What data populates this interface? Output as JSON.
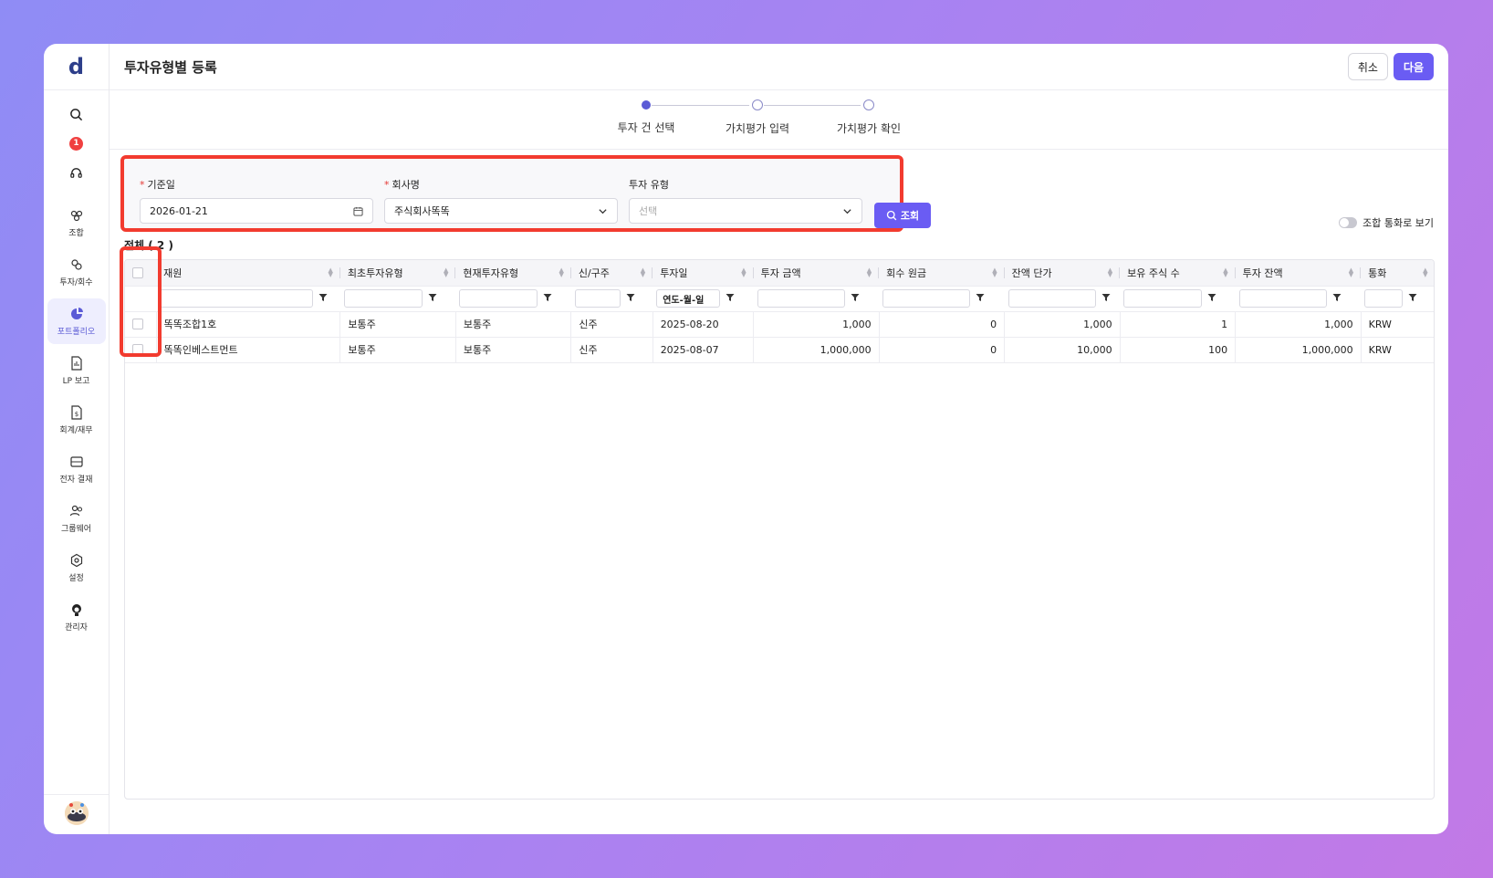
{
  "app": {
    "logo": "d"
  },
  "sidebar": {
    "notification_count": "1",
    "items": [
      {
        "label": "조합",
        "icon": "fund-icon",
        "active": false
      },
      {
        "label": "투자/회수",
        "icon": "invest-icon",
        "active": false
      },
      {
        "label": "포트폴리오",
        "icon": "portfolio-pie-icon",
        "active": true
      },
      {
        "label": "LP 보고",
        "icon": "report-icon",
        "active": false
      },
      {
        "label": "회계/재무",
        "icon": "accounting-icon",
        "active": false
      },
      {
        "label": "전자 결재",
        "icon": "approval-icon",
        "active": false
      },
      {
        "label": "그룹웨어",
        "icon": "groupware-icon",
        "active": false
      },
      {
        "label": "설정",
        "icon": "settings-icon",
        "active": false
      },
      {
        "label": "관리자",
        "icon": "admin-icon",
        "active": false
      }
    ]
  },
  "header": {
    "title": "투자유형별 등록",
    "cancel_label": "취소",
    "next_label": "다음"
  },
  "stepper": {
    "steps": [
      {
        "label": "투자 건 선택",
        "active": true
      },
      {
        "label": "가치평가 입력",
        "active": false
      },
      {
        "label": "가치평가 확인",
        "active": false
      }
    ]
  },
  "filters": {
    "base_date": {
      "label": "기준일",
      "required": "*",
      "value": "2026-01-21"
    },
    "company": {
      "label": "회사명",
      "required": "*",
      "value": "주식회사똑똑"
    },
    "invest_type": {
      "label": "투자 유형",
      "placeholder": "선택"
    },
    "search_label": "조회"
  },
  "toggle": {
    "label": "조합 통화로 보기"
  },
  "total_label": "전체 ( 2 )",
  "table": {
    "columns": [
      "재원",
      "최초투자유형",
      "현재투자유형",
      "신/구주",
      "투자일",
      "투자 금액",
      "회수 원금",
      "잔액 단가",
      "보유 주식 수",
      "투자 잔액",
      "통화"
    ],
    "date_filter_placeholder": "연도-월-일",
    "rows": [
      [
        "똑똑조합1호",
        "보통주",
        "보통주",
        "신주",
        "2025-08-20",
        "1,000",
        "0",
        "1,000",
        "1",
        "1,000",
        "KRW"
      ],
      [
        "똑똑인베스트먼트",
        "보통주",
        "보통주",
        "신주",
        "2025-08-07",
        "1,000,000",
        "0",
        "10,000",
        "100",
        "1,000,000",
        "KRW"
      ]
    ]
  },
  "colors": {
    "accent": "#6a5cf3",
    "highlight": "#f23b2f"
  }
}
